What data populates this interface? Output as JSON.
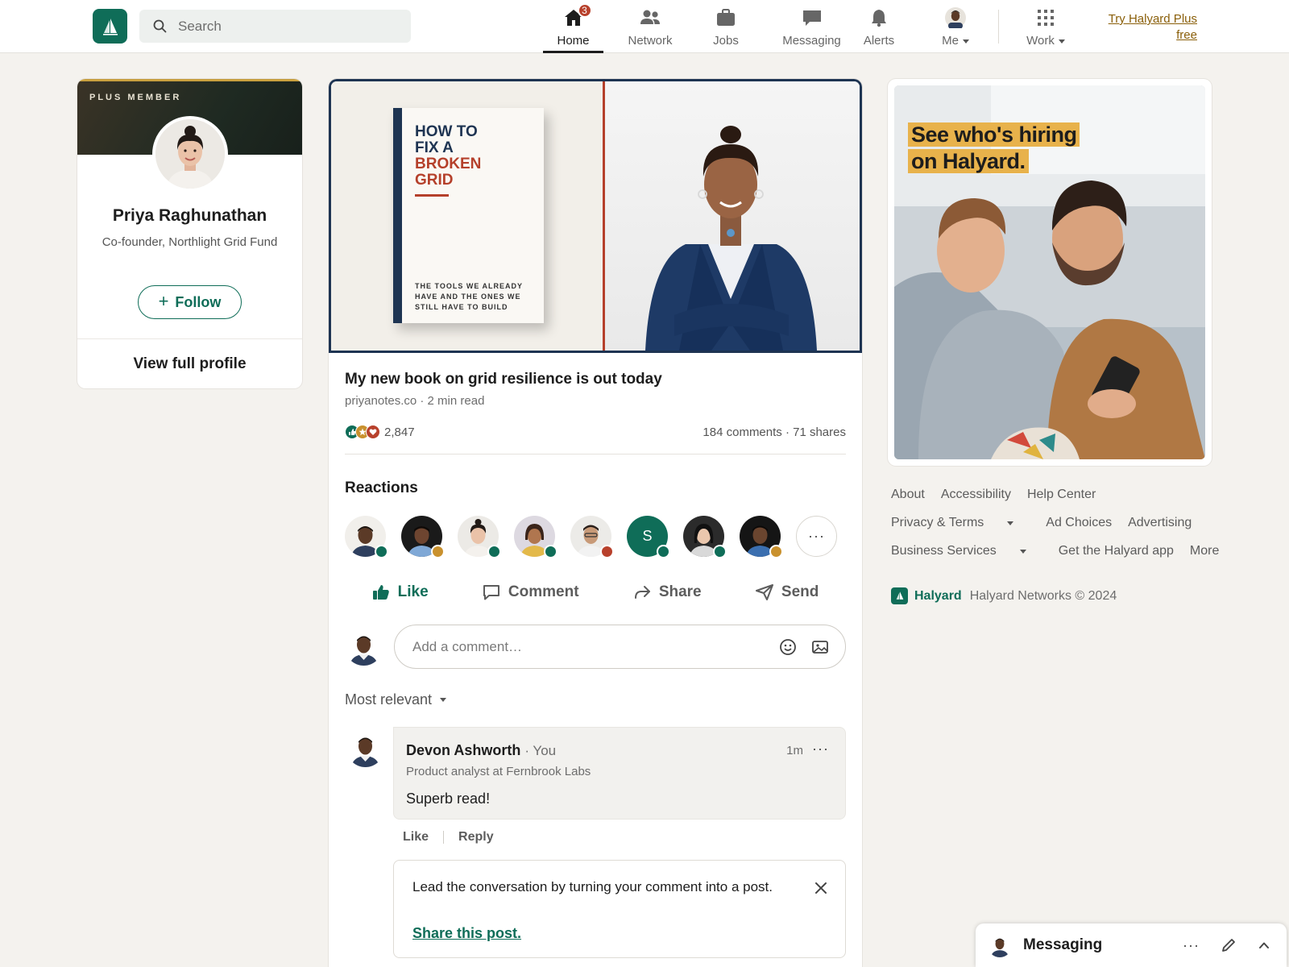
{
  "nav": {
    "search_placeholder": "Search",
    "items": [
      {
        "label": "Home",
        "icon": "home-icon",
        "badge": "3",
        "active": true
      },
      {
        "label": "Network",
        "icon": "network-icon"
      },
      {
        "label": "Jobs",
        "icon": "jobs-icon"
      },
      {
        "label": "Messaging",
        "icon": "messaging-icon"
      },
      {
        "label": "Alerts",
        "icon": "bell-icon"
      },
      {
        "label": "Me",
        "icon": "avatar"
      },
      {
        "label": "Work",
        "icon": "grid-icon"
      }
    ],
    "try_plus": "Try Halyard Plus free"
  },
  "profile": {
    "tag": "PLUS MEMBER",
    "name": "Priya Raghunathan",
    "headline": "Co-founder, Northlight Grid Fund",
    "follow_label": "Follow",
    "view_profile_label": "View full profile"
  },
  "post": {
    "book": {
      "title_line1": "HOW TO",
      "title_line2": "FIX A",
      "title_line3": "BROKEN",
      "title_line4": "GRID",
      "subtitle": "THE TOOLS WE ALREADY HAVE AND THE ONES WE STILL HAVE TO BUILD"
    },
    "title": "My new book on grid resilience is out today",
    "source": "priyanotes.co · 2 min read",
    "reaction_count": "2,847",
    "stats": "184 comments · 71 shares",
    "reactions_heading": "Reactions",
    "reactor_initial": "S",
    "actions": {
      "like": "Like",
      "comment": "Comment",
      "share": "Share",
      "send": "Send"
    },
    "comment_placeholder": "Add a comment…",
    "sort_label": "Most relevant"
  },
  "comment": {
    "author": "Devon Ashworth",
    "you_label": "· You",
    "role": "Product analyst at Fernbrook Labs",
    "time": "1m",
    "text": "Superb read!",
    "like_label": "Like",
    "reply_label": "Reply"
  },
  "tip": {
    "text": "Lead the conversation by turning your comment into a post.",
    "link": "Share this post."
  },
  "ad": {
    "line1": "See who's hiring",
    "line2": "on Halyard."
  },
  "footer": {
    "row1": [
      "About",
      "Accessibility",
      "Help Center"
    ],
    "row2": [
      "Privacy & Terms",
      "Ad Choices",
      "Advertising"
    ],
    "row3": [
      "Business Services",
      "Get the Halyard app",
      "More"
    ],
    "brand": "Halyard",
    "copyright": "Halyard Networks © 2024"
  },
  "messaging": {
    "title": "Messaging"
  },
  "colors": {
    "brand": "#0f6d58",
    "badge": "#b8412c",
    "plus_gold": "#c9a03f",
    "ad_highlight": "#e8b24b"
  }
}
